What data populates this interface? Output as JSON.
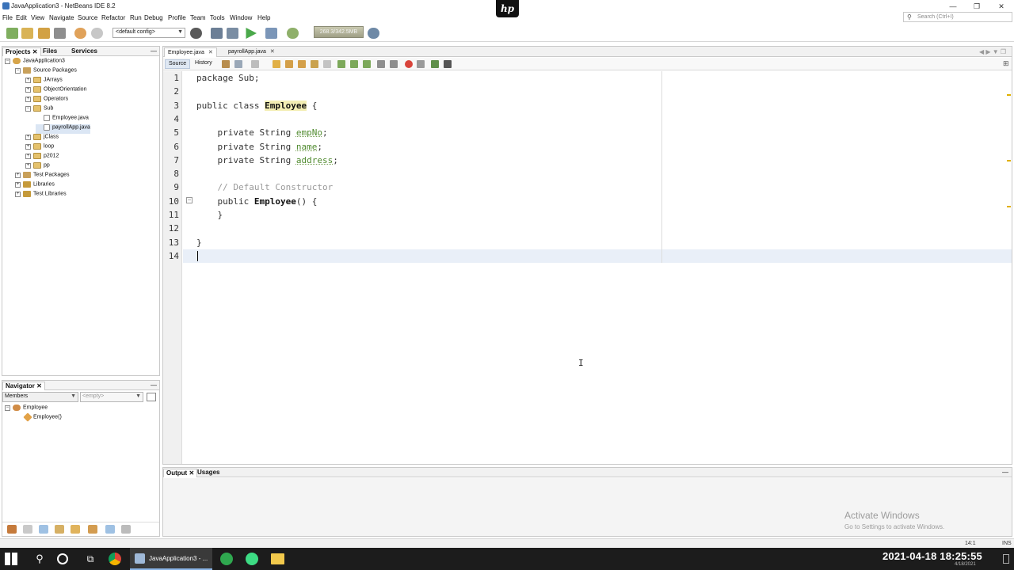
{
  "window": {
    "title": "JavaApplication3 - NetBeans IDE 8.2",
    "controls": [
      "—",
      "❐",
      "✕"
    ]
  },
  "menu": [
    "File",
    "Edit",
    "View",
    "Navigate",
    "Source",
    "Refactor",
    "Run",
    "Debug",
    "Profile",
    "Team",
    "Tools",
    "Window",
    "Help"
  ],
  "search": {
    "placeholder": "Search (Ctrl+I)"
  },
  "toolbar": {
    "config": "<default config>",
    "memory": "268.3/342.5MB"
  },
  "projects_panel": {
    "tabs": [
      "Projects",
      "Files",
      "Services"
    ],
    "tree": [
      {
        "label": "JavaApplication3",
        "depth": 0,
        "icon": "project-icon",
        "exp": "−"
      },
      {
        "label": "Source Packages",
        "depth": 1,
        "icon": "source-packages-icon",
        "exp": "−"
      },
      {
        "label": "JArrays",
        "depth": 2,
        "icon": "package-icon",
        "exp": "+"
      },
      {
        "label": "ObjectOrientation",
        "depth": 2,
        "icon": "package-icon",
        "exp": "+"
      },
      {
        "label": "Operators",
        "depth": 2,
        "icon": "package-icon",
        "exp": "+"
      },
      {
        "label": "Sub",
        "depth": 2,
        "icon": "package-icon",
        "exp": "−"
      },
      {
        "label": "Employee.java",
        "depth": 3,
        "icon": "java-file-icon",
        "exp": ""
      },
      {
        "label": "payrollApp.java",
        "depth": 3,
        "icon": "java-file-icon",
        "exp": "",
        "selected": true
      },
      {
        "label": "jClass",
        "depth": 2,
        "icon": "package-icon",
        "exp": "+"
      },
      {
        "label": "loop",
        "depth": 2,
        "icon": "package-icon",
        "exp": "+"
      },
      {
        "label": "p2012",
        "depth": 2,
        "icon": "package-icon",
        "exp": "+"
      },
      {
        "label": "pp",
        "depth": 2,
        "icon": "package-icon",
        "exp": "+"
      },
      {
        "label": "Test Packages",
        "depth": 1,
        "icon": "test-packages-icon",
        "exp": "+"
      },
      {
        "label": "Libraries",
        "depth": 1,
        "icon": "libraries-icon",
        "exp": "+"
      },
      {
        "label": "Test Libraries",
        "depth": 1,
        "icon": "test-libraries-icon",
        "exp": "+"
      }
    ]
  },
  "navigator": {
    "title": "Navigator",
    "filter": "Members",
    "empty": "<empty>",
    "items": [
      {
        "label": "Employee",
        "depth": 0
      },
      {
        "label": "Employee()",
        "depth": 1
      }
    ]
  },
  "editor": {
    "tabs": [
      "Employee.java",
      "payrollApp.java"
    ],
    "source_label": "Source",
    "history_label": "History",
    "lines": [
      {
        "n": "1",
        "parts": [
          [
            "kw",
            "package Sub;"
          ]
        ]
      },
      {
        "n": "2",
        "parts": []
      },
      {
        "n": "3",
        "parts": [
          [
            "kw",
            "public class "
          ],
          [
            "cls hl",
            "Employee"
          ],
          [
            "kw",
            " {"
          ]
        ]
      },
      {
        "n": "4",
        "parts": []
      },
      {
        "n": "5",
        "parts": [
          [
            "kw",
            "    private String "
          ],
          [
            "fld",
            "empNo"
          ],
          [
            "kw",
            ";"
          ]
        ]
      },
      {
        "n": "6",
        "parts": [
          [
            "kw",
            "    private String "
          ],
          [
            "fld",
            "name"
          ],
          [
            "kw",
            ";"
          ]
        ]
      },
      {
        "n": "7",
        "parts": [
          [
            "kw",
            "    private String "
          ],
          [
            "fld",
            "address"
          ],
          [
            "kw",
            ";"
          ]
        ]
      },
      {
        "n": "8",
        "parts": []
      },
      {
        "n": "9",
        "parts": [
          [
            "cmt",
            "    // Default Constructor"
          ]
        ]
      },
      {
        "n": "10",
        "parts": [
          [
            "kw",
            "    public "
          ],
          [
            "cls",
            "Employee"
          ],
          [
            "kw",
            "() {"
          ]
        ]
      },
      {
        "n": "11",
        "parts": [
          [
            "kw",
            "    }"
          ]
        ]
      },
      {
        "n": "12",
        "parts": []
      },
      {
        "n": "13",
        "parts": [
          [
            "kw",
            "}"
          ]
        ]
      },
      {
        "n": "14",
        "parts": []
      }
    ]
  },
  "output": {
    "tabs": [
      "Output",
      "Usages"
    ],
    "watermark_title": "Activate Windows",
    "watermark_sub": "Go to Settings to activate Windows."
  },
  "status": {
    "position": "14:1",
    "mode": "INS"
  },
  "taskbar": {
    "app_label": "JavaApplication3 - ...",
    "clock": "2021-04-18  18:25:55",
    "clock_sub": "4/18/2021"
  },
  "colors": {
    "keyword": "#333333",
    "field": "#4f8a2e",
    "comment": "#9a9a9a",
    "highlight": "#f3eeb4",
    "taskbar": "#1c1c1c"
  }
}
